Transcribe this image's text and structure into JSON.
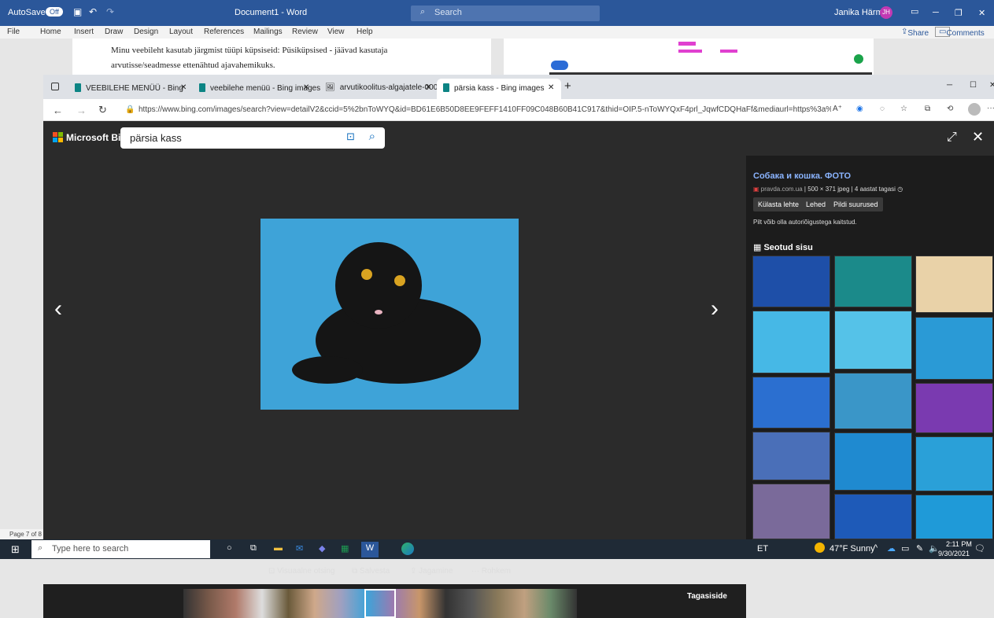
{
  "word": {
    "autosave": "AutoSave",
    "autosave_state": "Off",
    "doc_title": "Document1 - Word",
    "search": "Search",
    "user": "Janika Härma",
    "user_initials": "JH",
    "ribbon": [
      "File",
      "Home",
      "Insert",
      "Draw",
      "Design",
      "Layout",
      "References",
      "Mailings",
      "Review",
      "View",
      "Help"
    ],
    "share": "Share",
    "comments": "Comments",
    "doc_line1": "Minu veebileht kasutab järgmist tüüpi küpsiseid: Püsiküpsised - jäävad kasutaja",
    "doc_line2": "arvutisse/seadmesse ettenähtud ajavahemikuks.",
    "page_status": "Page 7 of 8"
  },
  "browser": {
    "tabs": [
      {
        "label": "VEEBILEHE MENÜÜ - Bing"
      },
      {
        "label": "veebilehe menüü - Bing images"
      },
      {
        "label": "arvutikoolitus-algajatele-000.jpg"
      },
      {
        "label": "pärsia kass - Bing images"
      }
    ],
    "new_tab": "+",
    "url": "https://www.bing.com/images/search?view=detailV2&ccid=5%2bnToWYQ&id=BD61E6B50D8EE9FEFF1410FF09C048B60B41C917&thid=OIP.5-nToWYQxF4prl_JqwfCDQHaFf&mediaurl=https%3a%2f%2fth.bing.c..."
  },
  "bing": {
    "brand": "Microsoft Bing",
    "query": "pärsia kass",
    "result_title": "Собака и кошка. ФОТО",
    "source": "pravda.com.ua",
    "meta": "500 × 371 jpeg  |  4 aastat tagasi",
    "buttons": [
      "Külasta lehte",
      "Lehed",
      "Pildi suurused"
    ],
    "copyright": "Pilt võib olla autoriõigustega kaitstud.",
    "related_heading": "Seotud sisu",
    "tools": [
      "Visuaalne otsing",
      "Salvesta",
      "Jagamine",
      "··· Rohkem"
    ],
    "feedback": "Tagasiside"
  },
  "taskbar": {
    "search_placeholder": "Type here to search",
    "lang": "ET",
    "weather": "47°F  Sunny",
    "time": "2:11 PM",
    "date": "9/30/2021"
  },
  "colors": {
    "word_blue": "#2b579a",
    "bing_dark": "#2b2b2b",
    "cat_bg": "#3ea3d8",
    "link": "#8ab4ff"
  }
}
